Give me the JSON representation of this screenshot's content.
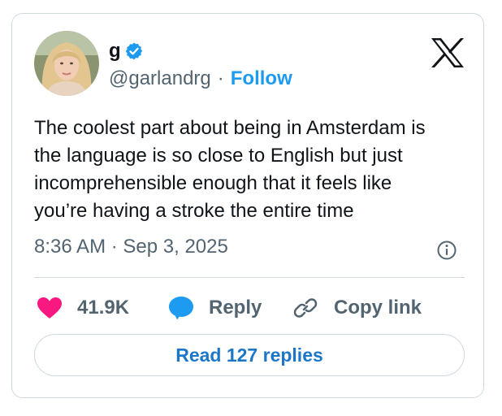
{
  "author": {
    "display_name": "g",
    "handle": "@garlandrg",
    "separator": "·",
    "follow_label": "Follow",
    "verified": true
  },
  "tweet": {
    "text": "The coolest part about being in Amsterdam is\nthe language is so close to English but just\nincomprehensible enough that it feels like\nyou’re having a stroke the entire time",
    "timestamp": "8:36 AM · Sep 3, 2025"
  },
  "actions": {
    "like_count": "41.9K",
    "reply_label": "Reply",
    "copy_link_label": "Copy link"
  },
  "read_replies_label": "Read 127 replies",
  "icons": {
    "platform": "x-logo-icon",
    "verified": "verified-badge-icon",
    "info": "info-icon",
    "like": "heart-icon",
    "reply": "speech-bubble-icon",
    "copy": "link-icon"
  },
  "colors": {
    "accent": "#1d9bf0",
    "like": "#f91880",
    "muted": "#536471",
    "text": "#0f1419",
    "border": "#cfd9de"
  }
}
